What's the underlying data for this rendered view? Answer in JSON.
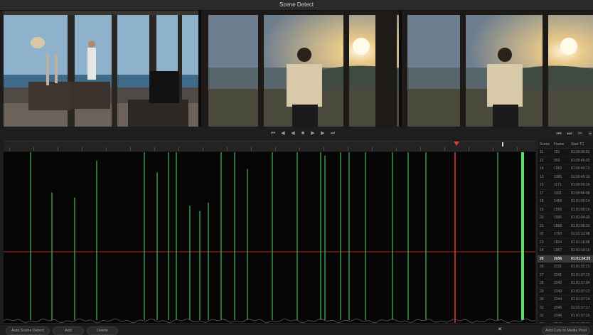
{
  "window": {
    "title": "Scene Detect"
  },
  "transport": {
    "buttons": [
      {
        "name": "go-to-start-icon",
        "glyph": "⏮"
      },
      {
        "name": "step-back-icon",
        "glyph": "◀"
      },
      {
        "name": "play-reverse-icon",
        "glyph": "◀"
      },
      {
        "name": "stop-icon",
        "glyph": "■"
      },
      {
        "name": "play-icon",
        "glyph": "▶"
      },
      {
        "name": "step-forward-icon",
        "glyph": "▶"
      },
      {
        "name": "go-to-end-icon",
        "glyph": "⏭"
      }
    ],
    "right_buttons": [
      {
        "name": "previous-cut-icon",
        "glyph": "⏮"
      },
      {
        "name": "next-cut-icon",
        "glyph": "⏭"
      },
      {
        "name": "scissors-icon",
        "glyph": "✂"
      },
      {
        "name": "menu-icon",
        "glyph": "≡"
      }
    ]
  },
  "scene_table": {
    "headers": [
      "Scene",
      "Frame",
      "Start TC"
    ],
    "rows": [
      [
        "11",
        "751",
        "01:00:30:01"
      ],
      [
        "12",
        "953",
        "01:00:46:03"
      ],
      [
        "14",
        "1063",
        "01:00:49:13"
      ],
      [
        "13",
        "1085",
        "01:00:45:10"
      ],
      [
        "15",
        "1171",
        "01:00:56:16"
      ],
      [
        "17",
        "1301",
        "01:00:56:08"
      ],
      [
        "18",
        "1459",
        "01:01:00:14"
      ],
      [
        "19",
        "1556",
        "01:01:00:16"
      ],
      [
        "20",
        "1556",
        "01:01:04:20"
      ],
      [
        "21",
        "1668",
        "01:01:06:10"
      ],
      [
        "22",
        "1763",
        "01:01:13:08"
      ],
      [
        "23",
        "1824",
        "01:01:16:08"
      ],
      [
        "24",
        "1967",
        "01:01:18:15"
      ],
      [
        "25",
        "2036",
        "01:01:24:20"
      ],
      [
        "26",
        "2231",
        "01:01:32:21"
      ],
      [
        "27",
        "2241",
        "01:01:37:13"
      ],
      [
        "28",
        "2242",
        "01:01:37:04"
      ],
      [
        "29",
        "2243",
        "01:01:37:12"
      ],
      [
        "30",
        "2244",
        "01:01:37:14"
      ],
      [
        "31",
        "2245",
        "01:01:37:17"
      ],
      [
        "32",
        "2246",
        "01:01:37:15"
      ],
      [
        "33",
        "2247",
        "01:01:37:19"
      ],
      [
        "34",
        "2248",
        "01:01:37:20"
      ]
    ],
    "selected_index": 13
  },
  "bottom": {
    "auto_scene_detect": "Auto Scene Detect",
    "add": "Add",
    "delete": "Delete",
    "add_cuts": "Add Cuts to Media Pool",
    "close_glyph": "✕"
  },
  "colors": {
    "accent_red": "#e03b2b",
    "cut_green": "#3fbf57",
    "bright_green": "#54e06a"
  }
}
